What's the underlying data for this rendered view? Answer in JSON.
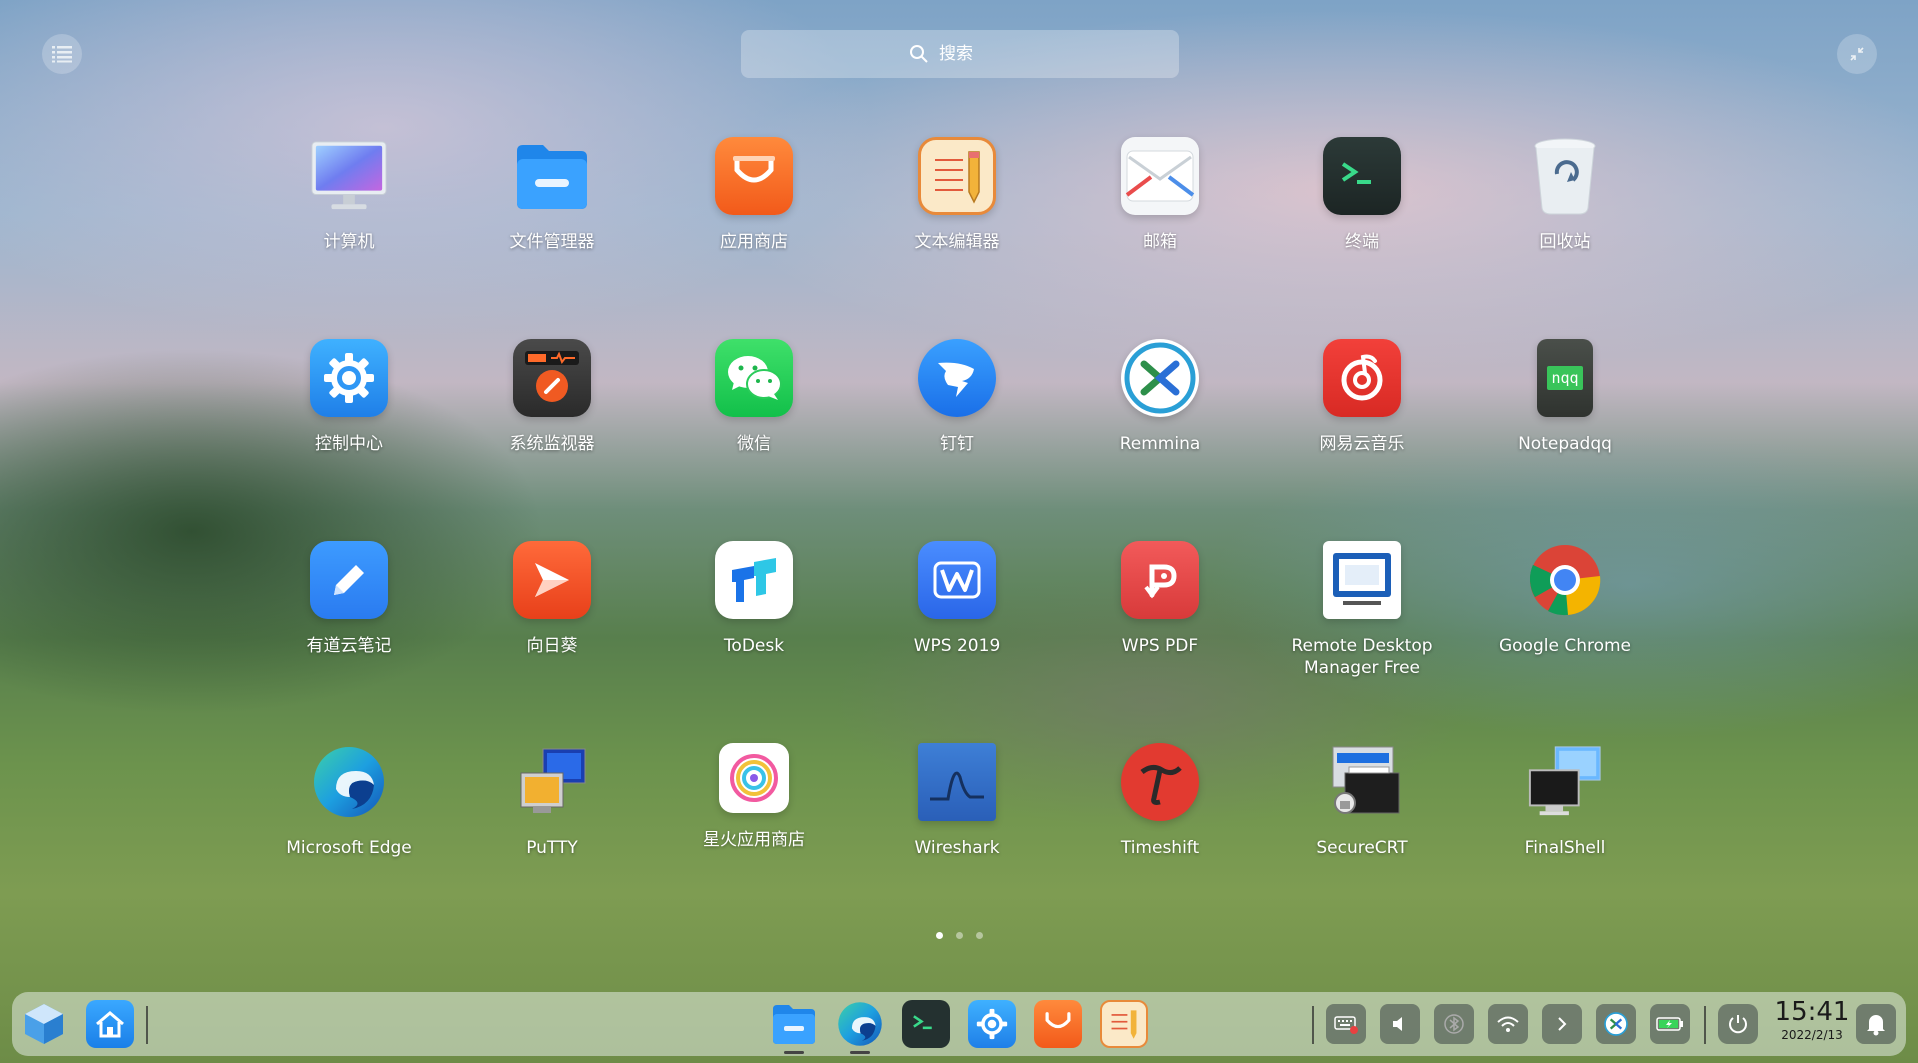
{
  "search": {
    "placeholder": "搜索"
  },
  "apps": [
    {
      "label": "计算机",
      "icon": "computer-icon"
    },
    {
      "label": "文件管理器",
      "icon": "file-manager-icon"
    },
    {
      "label": "应用商店",
      "icon": "app-store-icon"
    },
    {
      "label": "文本编辑器",
      "icon": "text-editor-icon"
    },
    {
      "label": "邮箱",
      "icon": "mail-icon"
    },
    {
      "label": "终端",
      "icon": "terminal-icon"
    },
    {
      "label": "回收站",
      "icon": "trash-icon"
    },
    {
      "label": "控制中心",
      "icon": "control-center-icon"
    },
    {
      "label": "系统监视器",
      "icon": "system-monitor-icon"
    },
    {
      "label": "微信",
      "icon": "wechat-icon"
    },
    {
      "label": "钉钉",
      "icon": "dingtalk-icon"
    },
    {
      "label": "Remmina",
      "icon": "remmina-icon"
    },
    {
      "label": "网易云音乐",
      "icon": "netease-music-icon"
    },
    {
      "label": "Notepadqq",
      "icon": "notepadqq-icon",
      "icon_text": "nqq"
    },
    {
      "label": "有道云笔记",
      "icon": "youdao-note-icon"
    },
    {
      "label": "向日葵",
      "icon": "sunlogin-icon"
    },
    {
      "label": "ToDesk",
      "icon": "todesk-icon"
    },
    {
      "label": "WPS 2019",
      "icon": "wps-icon"
    },
    {
      "label": "WPS PDF",
      "icon": "wps-pdf-icon"
    },
    {
      "label": "Remote Desktop Manager Free",
      "icon": "remote-desktop-icon"
    },
    {
      "label": "Google Chrome",
      "icon": "chrome-icon"
    },
    {
      "label": "Microsoft Edge",
      "icon": "edge-icon"
    },
    {
      "label": "PuTTY",
      "icon": "putty-icon"
    },
    {
      "label": "星火应用商店",
      "icon": "spark-store-icon"
    },
    {
      "label": "Wireshark",
      "icon": "wireshark-icon"
    },
    {
      "label": "Timeshift",
      "icon": "timeshift-icon"
    },
    {
      "label": "SecureCRT",
      "icon": "securecrt-icon"
    },
    {
      "label": "FinalShell",
      "icon": "finalshell-icon"
    }
  ],
  "pages": {
    "count": 3,
    "active": 1
  },
  "dock": {
    "left": [
      {
        "name": "launcher",
        "icon": "launcher-cube-icon"
      },
      {
        "name": "home",
        "icon": "home-icon"
      }
    ],
    "center": [
      {
        "name": "file-manager",
        "icon": "file-manager-icon"
      },
      {
        "name": "edge",
        "icon": "edge-icon"
      },
      {
        "name": "terminal",
        "icon": "terminal-icon"
      },
      {
        "name": "control-center",
        "icon": "control-center-icon"
      },
      {
        "name": "app-store",
        "icon": "app-store-icon"
      },
      {
        "name": "text-editor",
        "icon": "text-editor-icon"
      }
    ],
    "tray": [
      {
        "name": "keyboard",
        "icon": "keyboard-icon"
      },
      {
        "name": "volume",
        "icon": "volume-icon"
      },
      {
        "name": "bluetooth",
        "icon": "bluetooth-icon"
      },
      {
        "name": "wifi",
        "icon": "wifi-icon"
      },
      {
        "name": "expand",
        "icon": "chevron-right-icon"
      },
      {
        "name": "remmina",
        "icon": "remmina-icon"
      },
      {
        "name": "battery",
        "icon": "battery-icon"
      }
    ],
    "clock": {
      "time": "15:41",
      "date": "2022/2/13"
    }
  }
}
